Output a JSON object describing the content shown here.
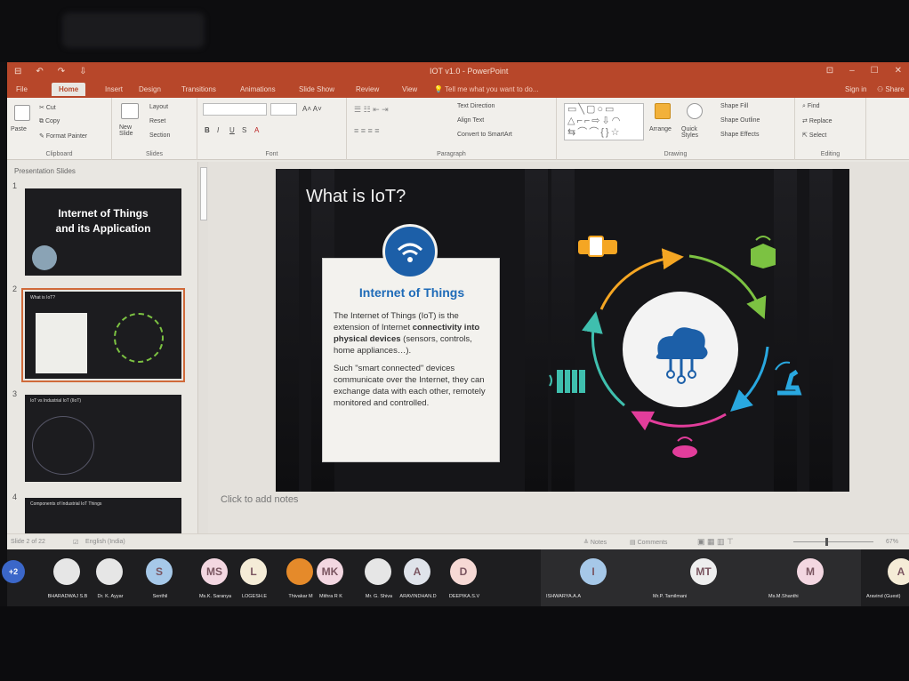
{
  "titlebar": {
    "qat": [
      "⊟",
      "↶",
      "↷",
      "⇩"
    ],
    "title": "IOT v1.0 - PowerPoint",
    "window_controls": [
      "⊡",
      "–",
      "☐",
      "✕"
    ]
  },
  "tabs": [
    "File",
    "Home",
    "Insert",
    "Design",
    "Transitions",
    "Animations",
    "Slide Show",
    "Review",
    "View"
  ],
  "tell_me": "Tell me what you want to do...",
  "account": {
    "sign_in": "Sign in",
    "share": "Share"
  },
  "ribbon": {
    "clipboard": {
      "paste": "Paste",
      "cut": "Cut",
      "copy": "Copy",
      "format_painter": "Format Painter",
      "label": "Clipboard"
    },
    "slides": {
      "new_slide": "New Slide",
      "layout": "Layout",
      "reset": "Reset",
      "section": "Section",
      "label": "Slides"
    },
    "font": {
      "label": "Font",
      "bold": "B",
      "italic": "I",
      "underline": "U",
      "strike": "S"
    },
    "paragraph": {
      "text_direction": "Text Direction",
      "align_text": "Align Text",
      "convert": "Convert to SmartArt",
      "label": "Paragraph"
    },
    "drawing": {
      "arrange": "Arrange",
      "quick_styles": "Quick Styles",
      "shape_fill": "Shape Fill",
      "shape_outline": "Shape Outline",
      "shape_effects": "Shape Effects",
      "label": "Drawing"
    },
    "editing": {
      "find": "Find",
      "replace": "Replace",
      "select": "Select",
      "label": "Editing"
    }
  },
  "thumbs": {
    "header": "Presentation Slides",
    "items": [
      {
        "num": "1",
        "title": "Internet of Things and its Application"
      },
      {
        "num": "2",
        "title": "What is IoT?"
      },
      {
        "num": "3",
        "title": "IoT vs Industrial IoT (IIoT)"
      },
      {
        "num": "4",
        "title": "Components of Industrial IoT Things"
      }
    ]
  },
  "slide": {
    "title": "What is IoT?",
    "card_title": "Internet of Things",
    "para1_a": "The Internet of Things (IoT) is the extension of Internet ",
    "para1_b": "connectivity into physical devices",
    "para1_c": " (sensors, controls, home appliances…).",
    "para2": "Such \"smart connected\" devices communicate over the Internet, they can exchange data with each other, remotely monitored and controlled.",
    "colors": {
      "orange": "#f5a623",
      "green": "#7cc242",
      "blue": "#29a8e0",
      "pink": "#e23d9b",
      "teal": "#3fbfae",
      "card_blue": "#1c5fa8"
    }
  },
  "notes_placeholder": "Click to add notes",
  "status": {
    "slide_of": "Slide 2 of 22",
    "language": "English (India)",
    "notes": "Notes",
    "comments": "Comments",
    "zoom": "67%"
  },
  "participants": [
    {
      "initials": "+2",
      "name": "",
      "color": "#3b67c9"
    },
    {
      "initials": "",
      "name": "BHARADWAJ S.B",
      "color": "#e6e6e6"
    },
    {
      "initials": "",
      "name": "Dr. K. Ayyar",
      "color": "#e6e6e6"
    },
    {
      "initials": "S",
      "name": "Senthil",
      "color": "#a6c8e8"
    },
    {
      "initials": "MS",
      "name": "Ms.K. Saranya",
      "color": "#f3d7e1"
    },
    {
      "initials": "L",
      "name": "LOGESH.E",
      "color": "#f5ecd7"
    },
    {
      "initials": "",
      "name": "Thivakar M",
      "color": "#e58a2a"
    },
    {
      "initials": "MK",
      "name": "Mithra R K",
      "color": "#f3d7e1"
    },
    {
      "initials": "",
      "name": "Mr. G. Shiva",
      "color": "#e6e6e6"
    },
    {
      "initials": "A",
      "name": "ARAVINDHAN.D",
      "color": "#dfe3ea"
    },
    {
      "initials": "D",
      "name": "DEEPIKA.S.V",
      "color": "#f6d9d5"
    },
    {
      "initials": "I",
      "name": "ISHWARYA.A.A",
      "color": "#a6c8e8"
    },
    {
      "initials": "MT",
      "name": "Mr.P. Tamilmani",
      "color": "#eeeeee"
    },
    {
      "initials": "M",
      "name": "Ms.M.Shanthi",
      "color": "#f3d7e1"
    },
    {
      "initials": "A",
      "name": "Aravind (Guest)",
      "color": "#f5ecd7"
    }
  ]
}
